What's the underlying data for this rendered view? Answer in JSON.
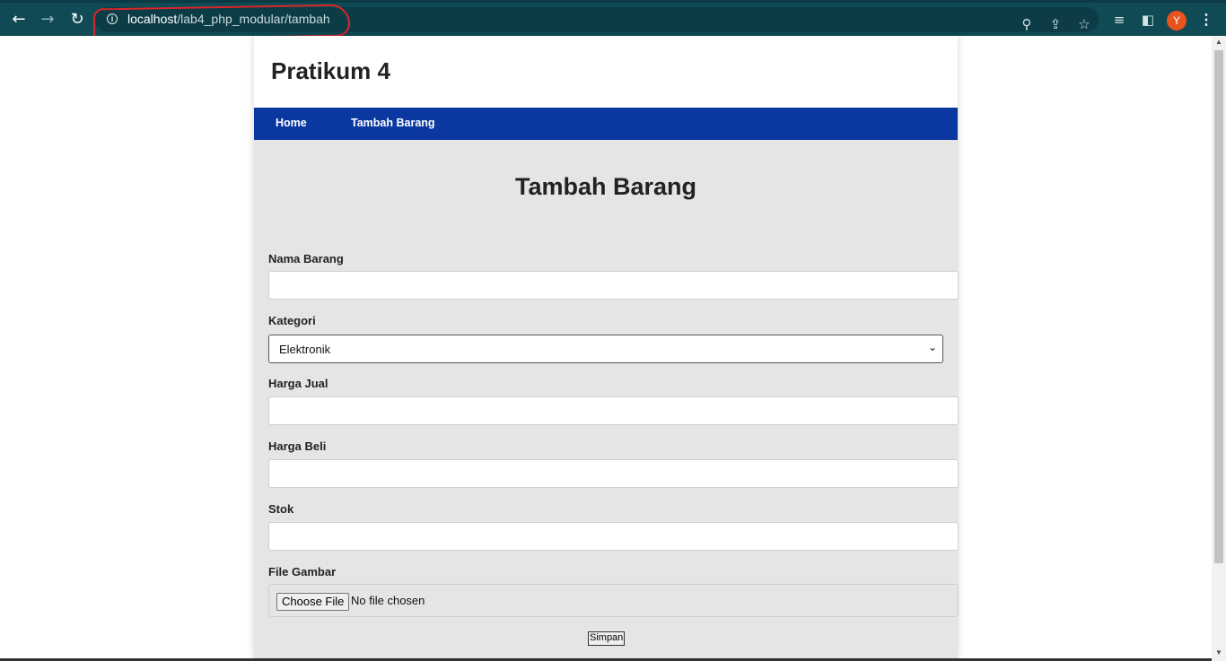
{
  "browser": {
    "url_host": "localhost",
    "url_path": "/lab4_php_modular/tambah",
    "profile_initial": "Y",
    "icons": {
      "back": "back-arrow-icon",
      "forward": "forward-arrow-icon",
      "reload": "reload-icon",
      "info": "info-icon",
      "zoom": "zoom-icon",
      "share": "share-icon",
      "bookmark": "star-icon",
      "reading_list": "reading-list-icon",
      "side_panel": "side-panel-icon",
      "menu": "kebab-menu-icon"
    },
    "colors": {
      "toolbar": "#0f4a55",
      "annotation": "#d9262b"
    }
  },
  "site": {
    "title": "Pratikum 4",
    "nav": [
      {
        "label": "Home"
      },
      {
        "label": "Tambah Barang"
      }
    ],
    "colors": {
      "nav": "#0a37a0",
      "content_bg": "#e5e5e5"
    }
  },
  "form": {
    "heading": "Tambah Barang",
    "fields": {
      "nama_barang": {
        "label": "Nama Barang",
        "value": ""
      },
      "kategori": {
        "label": "Kategori",
        "selected": "Elektronik"
      },
      "harga_jual": {
        "label": "Harga Jual",
        "value": ""
      },
      "harga_beli": {
        "label": "Harga Beli",
        "value": ""
      },
      "stok": {
        "label": "Stok",
        "value": ""
      },
      "file_gambar": {
        "label": "File Gambar",
        "button": "Choose File",
        "status": "No file chosen"
      }
    },
    "submit": "Simpan"
  }
}
